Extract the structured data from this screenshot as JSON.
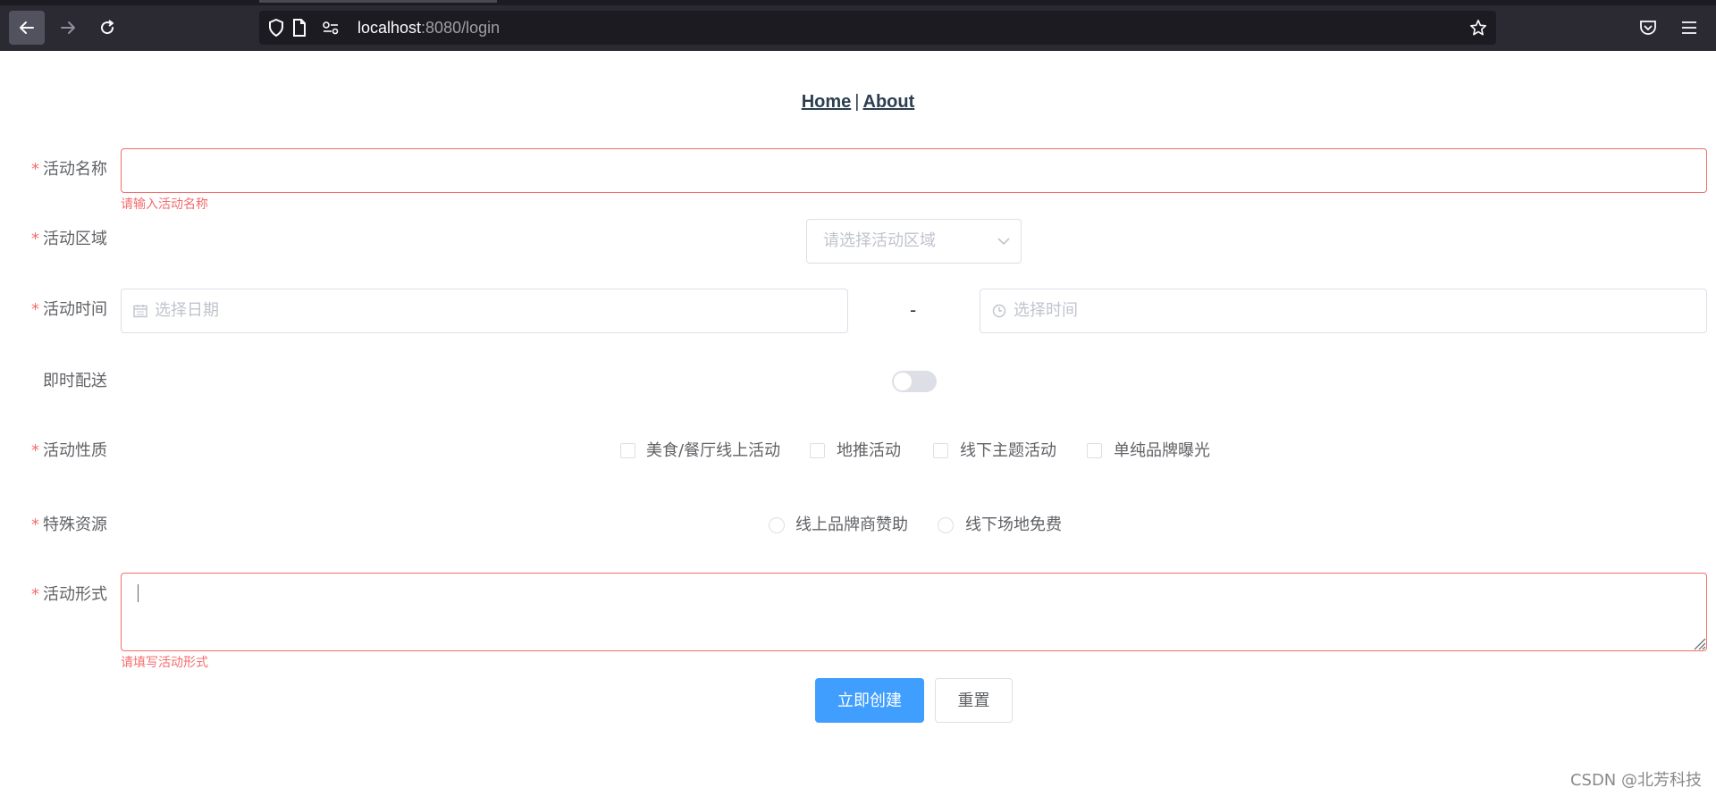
{
  "browser": {
    "url_host": "localhost",
    "url_rest": ":8080/login",
    "icons": [
      "back-arrow-icon",
      "forward-arrow-icon",
      "reload-icon",
      "shield-icon",
      "page-icon",
      "permissions-icon",
      "bookmark-star-icon",
      "pocket-icon",
      "hamburger-menu-icon"
    ]
  },
  "nav": {
    "home": "Home",
    "separator": "|",
    "about": "About"
  },
  "form": {
    "required_mark": "*",
    "name": {
      "label": "活动名称",
      "value": "",
      "error": "请输入活动名称"
    },
    "region": {
      "label": "活动区域",
      "placeholder": "请选择活动区域"
    },
    "time": {
      "label": "活动时间",
      "date_placeholder": "选择日期",
      "separator": "-",
      "time_placeholder": "选择时间"
    },
    "delivery": {
      "label": "即时配送",
      "enabled": false
    },
    "type": {
      "label": "活动性质",
      "options": [
        "美食/餐厅线上活动",
        "地推活动",
        "线下主题活动",
        "单纯品牌曝光"
      ]
    },
    "resource": {
      "label": "特殊资源",
      "options": [
        "线上品牌商赞助",
        "线下场地免费"
      ]
    },
    "desc": {
      "label": "活动形式",
      "value": "",
      "error": "请填写活动形式"
    }
  },
  "buttons": {
    "create": "立即创建",
    "reset": "重置"
  },
  "watermark": "CSDN @北芳科技",
  "colors": {
    "primary": "#409eff",
    "error": "#f56c6c",
    "border": "#dcdfe6",
    "placeholder": "#c0c4cc"
  }
}
